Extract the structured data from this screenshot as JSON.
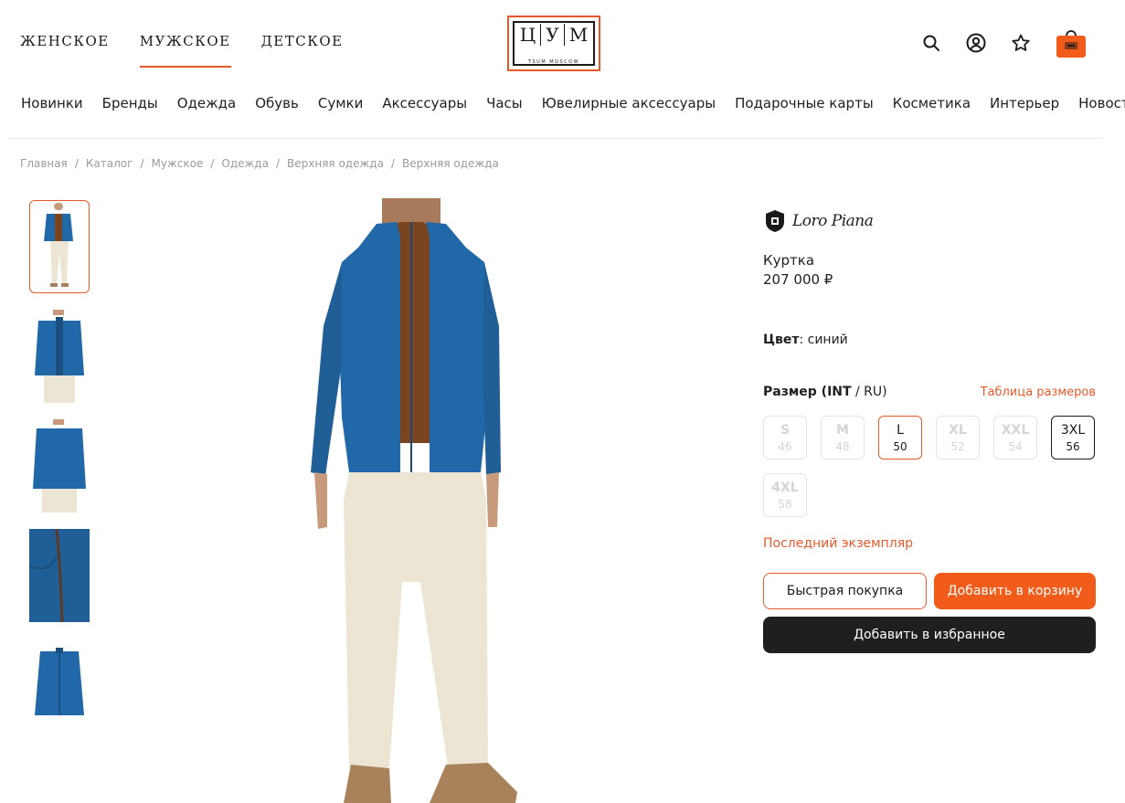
{
  "header": {
    "gender_tabs": [
      {
        "label": "ЖЕНСКОЕ"
      },
      {
        "label": "МУЖСКОЕ"
      },
      {
        "label": "ДЕТСКОЕ"
      }
    ],
    "logo": {
      "letters": [
        "Ц",
        "У",
        "М"
      ],
      "subtitle": "TSUM MOSCOW"
    },
    "icons": [
      "search-icon",
      "account-icon",
      "favorites-icon",
      "cart-bag-icon"
    ]
  },
  "categories": [
    "Новинки",
    "Бренды",
    "Одежда",
    "Обувь",
    "Сумки",
    "Аксессуары",
    "Часы",
    "Ювелирные аксессуары",
    "Подарочные карты",
    "Косметика",
    "Интерьер",
    "Новости"
  ],
  "breadcrumb": [
    "Главная",
    "Каталог",
    "Мужское",
    "Одежда",
    "Верхняя одежда",
    "Верхняя одежда"
  ],
  "product": {
    "brand": "Loro Piana",
    "type": "Куртка",
    "price": "207 000 ₽",
    "color_label": "Цвет",
    "color_value": ": синий",
    "size_label_bold": "Размер (INT",
    "size_label_rest": " / RU)",
    "size_chart_link": "Таблица размеров",
    "sizes": [
      {
        "int": "S",
        "ru": "46",
        "state": "unavailable"
      },
      {
        "int": "M",
        "ru": "48",
        "state": "unavailable"
      },
      {
        "int": "L",
        "ru": "50",
        "state": "selected"
      },
      {
        "int": "XL",
        "ru": "52",
        "state": "unavailable"
      },
      {
        "int": "XXL",
        "ru": "54",
        "state": "unavailable"
      },
      {
        "int": "3XL",
        "ru": "56",
        "state": "available"
      },
      {
        "int": "4XL",
        "ru": "58",
        "state": "unavailable"
      }
    ],
    "stock_note": "Последний экземпляр",
    "buttons": {
      "quick_buy": "Быстрая покупка",
      "add_to_cart": "Добавить в корзину",
      "add_to_favorites": "Добавить в избранное"
    }
  },
  "colors": {
    "accent": "#e8592a",
    "jacket": "#2168a8",
    "shirt": "#7a4420",
    "pants": "#ede5d4",
    "shoes": "#a9825c"
  }
}
